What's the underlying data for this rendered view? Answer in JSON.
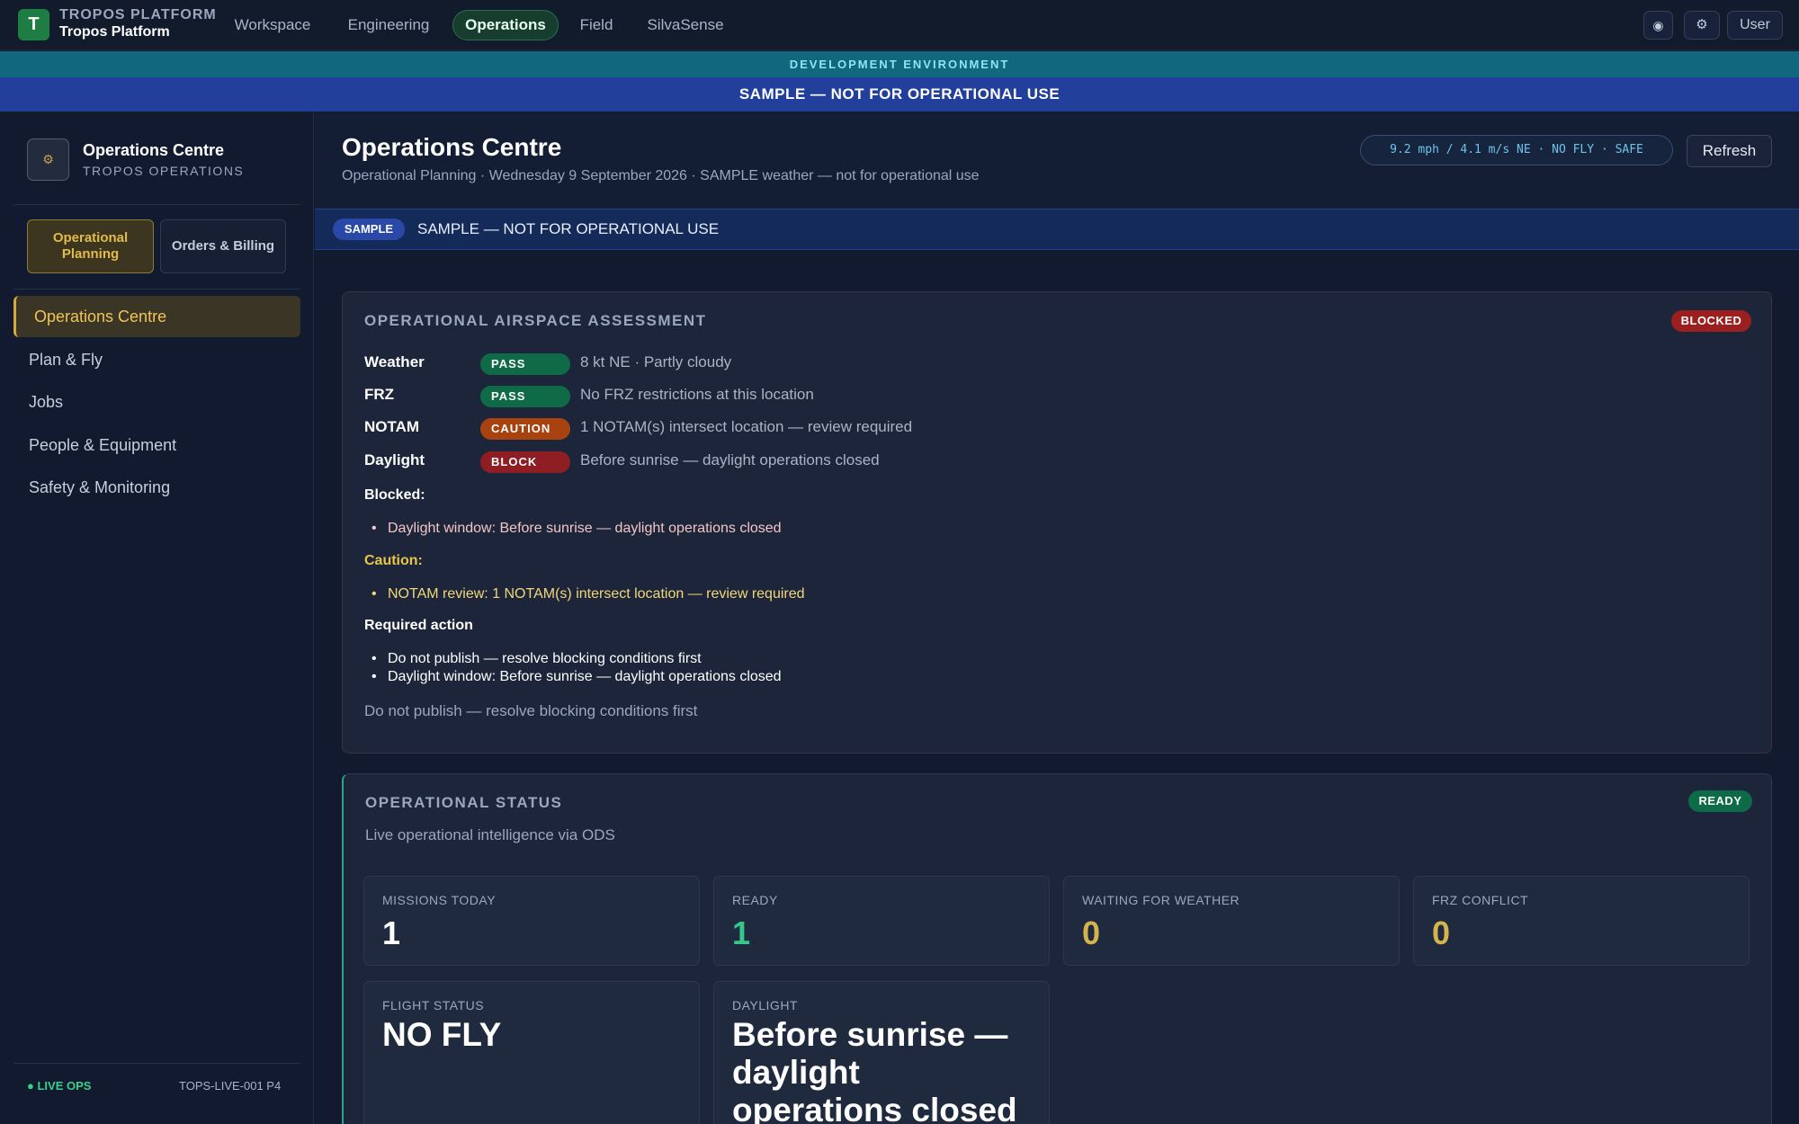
{
  "topbar": {
    "logo_letter": "T",
    "brand_top": "TROPOS PLATFORM",
    "brand_bottom": "Tropos Platform",
    "nav": [
      "Workspace",
      "Engineering",
      "Operations",
      "Field",
      "SilvaSense"
    ],
    "active_nav": "Operations",
    "icon_button_1": "◉",
    "icon_button_2": "⚙",
    "user_label": "User"
  },
  "env_banner": "DEVELOPMENT ENVIRONMENT",
  "sample_banner": "SAMPLE — NOT FOR OPERATIONAL USE",
  "sidebar": {
    "icon_glyph": "⚙",
    "title": "Operations Centre",
    "subtitle": "TROPOS OPERATIONS",
    "modes": [
      "Operational Planning",
      "Orders & Billing"
    ],
    "items": [
      "Operations Centre",
      "Plan & Fly",
      "Jobs",
      "People & Equipment",
      "Safety & Monitoring"
    ],
    "active_item": "Operations Centre",
    "footer_status": "● LIVE OPS",
    "footer_id": "TOPS-LIVE-001 P4"
  },
  "header": {
    "title": "Operations Centre",
    "subtitle": "Operational Planning · Wednesday 9 September 2026 · SAMPLE weather — not for operational use",
    "weather_pill": "9.2 mph / 4.1 m/s NE · NO FLY · SAFE",
    "refresh_label": "Refresh"
  },
  "sample_strip": {
    "badge": "SAMPLE",
    "text": "SAMPLE — NOT FOR OPERATIONAL USE"
  },
  "airspace": {
    "title": "OPERATIONAL AIRSPACE ASSESSMENT",
    "badge": "BLOCKED",
    "checks": [
      {
        "label": "Weather",
        "status": "PASS",
        "detail": "8 kt NE · Partly cloudy"
      },
      {
        "label": "FRZ",
        "status": "PASS",
        "detail": "No FRZ restrictions at this location"
      },
      {
        "label": "NOTAM",
        "status": "CAUTION",
        "detail": "1 NOTAM(s) intersect location — review required"
      },
      {
        "label": "Daylight",
        "status": "BLOCK",
        "detail": "Before sunrise — daylight operations closed"
      }
    ],
    "blocked_heading": "Blocked:",
    "blocked_items": [
      "Daylight window: Before sunrise — daylight operations closed"
    ],
    "caution_heading": "Caution:",
    "caution_items": [
      "NOTAM review: 1 NOTAM(s) intersect location — review required"
    ],
    "action_heading": "Required action",
    "action_items": [
      "Do not publish — resolve blocking conditions first",
      "Daylight window: Before sunrise — daylight operations closed"
    ],
    "note": "Do not publish — resolve blocking conditions first"
  },
  "status": {
    "title": "OPERATIONAL STATUS",
    "badge": "READY",
    "subtitle": "Live operational intelligence via ODS",
    "metrics": [
      {
        "label": "MISSIONS TODAY",
        "value": "1"
      },
      {
        "label": "READY",
        "value": "1"
      },
      {
        "label": "WAITING FOR WEATHER",
        "value": "0"
      },
      {
        "label": "FRZ CONFLICT",
        "value": "0"
      }
    ],
    "flight_status_label": "FLIGHT STATUS",
    "flight_status_value": "NO FLY",
    "daylight_label": "DAYLIGHT",
    "daylight_value": "Before sunrise — daylight operations closed"
  },
  "colors": {
    "accent_gold": "#d8a93a",
    "pass_green": "#0f6b47",
    "caution_orange": "#a8420f",
    "block_red": "#8f1e24",
    "ready_value": "#35c78a",
    "warn_value": "#d6b44d"
  }
}
